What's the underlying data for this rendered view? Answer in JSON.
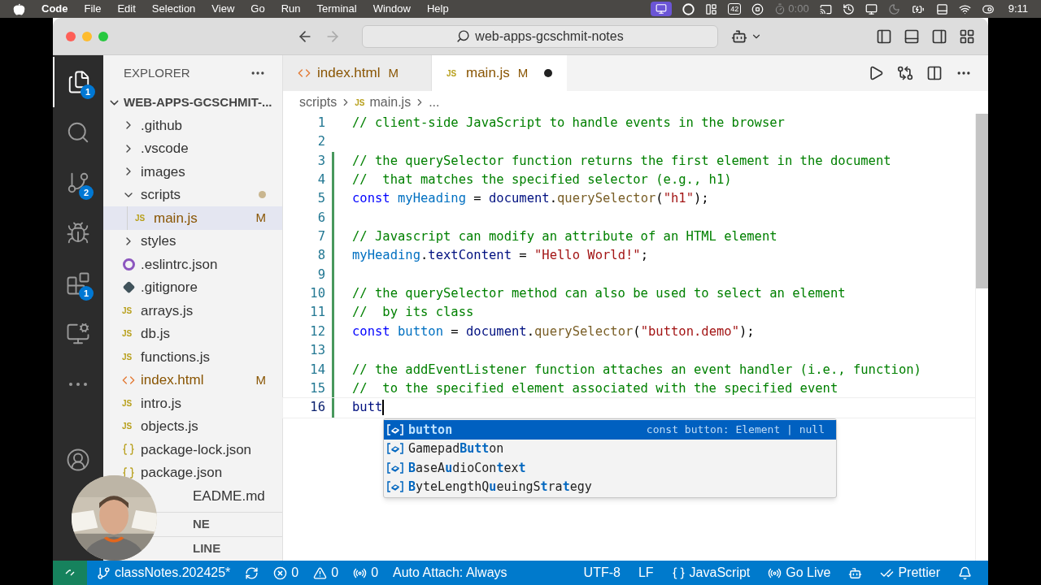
{
  "menu_bar": {
    "app": "Code",
    "menus": [
      "File",
      "Edit",
      "Selection",
      "View",
      "Go",
      "Run",
      "Terminal",
      "Window",
      "Help"
    ],
    "badge": "42",
    "timer": "0:00",
    "clock": "9:11"
  },
  "title_bar": {
    "search": "web-apps-gcschmit-notes"
  },
  "activity_bar": {
    "top": [
      {
        "kind": "files",
        "selected": true,
        "badge": "1"
      },
      {
        "kind": "search",
        "selected": false
      },
      {
        "kind": "source-control",
        "selected": false,
        "badge": "2"
      },
      {
        "kind": "run",
        "selected": false
      },
      {
        "kind": "extensions",
        "selected": false,
        "badge": "1"
      },
      {
        "kind": "remote",
        "selected": false
      },
      {
        "kind": "more",
        "selected": false
      }
    ],
    "bottom": [
      {
        "kind": "account",
        "selected": false
      }
    ]
  },
  "sidebar": {
    "title": "EXPLORER",
    "root": {
      "label": "WEB-APPS-GCSCHMIT-...",
      "expanded": true
    },
    "items": [
      {
        "label": ".github",
        "kind": "folder",
        "expanded": false,
        "selected": false
      },
      {
        "label": ".vscode",
        "kind": "folder",
        "expanded": false,
        "selected": false
      },
      {
        "label": "images",
        "kind": "folder",
        "expanded": false,
        "selected": false
      },
      {
        "label": "scripts",
        "kind": "folder",
        "expanded": true,
        "dot": true,
        "selected": false,
        "children": [
          {
            "label": "main.js",
            "kind": "js",
            "icon_text": "JS",
            "badge": "M",
            "selected": true
          }
        ]
      },
      {
        "label": "styles",
        "kind": "folder",
        "expanded": false,
        "selected": false
      },
      {
        "label": ".eslintrc.json",
        "kind": "eslint",
        "selected": false
      },
      {
        "label": ".gitignore",
        "kind": "git",
        "selected": false
      },
      {
        "label": "arrays.js",
        "kind": "js",
        "icon_text": "JS",
        "selected": false
      },
      {
        "label": "db.js",
        "kind": "js",
        "icon_text": "JS",
        "selected": false
      },
      {
        "label": "functions.js",
        "kind": "js",
        "icon_text": "JS",
        "selected": false
      },
      {
        "label": "index.html",
        "kind": "html",
        "badge": "M",
        "selected": false
      },
      {
        "label": "intro.js",
        "kind": "js",
        "icon_text": "JS",
        "selected": false
      },
      {
        "label": "objects.js",
        "kind": "js",
        "icon_text": "JS",
        "selected": false
      },
      {
        "label": "package-lock.json",
        "kind": "json",
        "selected": false
      },
      {
        "label": "package.json",
        "kind": "json",
        "selected": false
      },
      {
        "label": "EADME.md",
        "kind": "md",
        "occluded": true,
        "selected": false
      }
    ],
    "sections": [
      "NE",
      "LINE"
    ]
  },
  "tabs": [
    {
      "label": "index.html",
      "kind": "html",
      "badge": "M",
      "selected": false,
      "dirty": false
    },
    {
      "label": "main.js",
      "kind": "js",
      "icon_text": "JS",
      "badge": "M",
      "selected": true,
      "dirty": true
    }
  ],
  "breadcrumb": [
    {
      "label": "scripts"
    },
    {
      "label": "main.js",
      "icon_text": "JS"
    },
    {
      "label": "..."
    }
  ],
  "editor": {
    "lines": [
      {
        "n": "1",
        "modified": false,
        "tokens": [
          {
            "kind": "comment",
            "text": "// client-side JavaScript to handle events in the browser"
          }
        ]
      },
      {
        "n": "2",
        "modified": false
      },
      {
        "n": "3",
        "modified": true,
        "tokens": [
          {
            "kind": "comment",
            "text": "// the querySelector function returns the first element in the document"
          }
        ]
      },
      {
        "n": "4",
        "modified": true,
        "tokens": [
          {
            "kind": "comment",
            "text": "//  that matches the specified selector (e.g., h1)"
          }
        ]
      },
      {
        "n": "5",
        "modified": true,
        "tokens": [
          {
            "kind": "keyword",
            "text": "const"
          },
          {
            "kind": "variable",
            "text": " myHeading"
          },
          {
            "kind": "plain",
            "text": " = "
          },
          {
            "kind": "property",
            "text": "document"
          },
          {
            "kind": "plain",
            "text": "."
          },
          {
            "kind": "function",
            "text": "querySelector"
          },
          {
            "kind": "plain",
            "text": "("
          },
          {
            "kind": "string",
            "text": "\"h1\""
          },
          {
            "kind": "plain",
            "text": ");"
          }
        ]
      },
      {
        "n": "6",
        "modified": true
      },
      {
        "n": "7",
        "modified": true,
        "tokens": [
          {
            "kind": "comment",
            "text": "// Javascript can modify an attribute of an HTML element"
          }
        ]
      },
      {
        "n": "8",
        "modified": true,
        "tokens": [
          {
            "kind": "variable",
            "text": "myHeading"
          },
          {
            "kind": "plain",
            "text": "."
          },
          {
            "kind": "property",
            "text": "textContent"
          },
          {
            "kind": "plain",
            "text": " = "
          },
          {
            "kind": "string",
            "text": "\"Hello World!\""
          },
          {
            "kind": "plain",
            "text": ";"
          }
        ]
      },
      {
        "n": "9",
        "modified": true
      },
      {
        "n": "10",
        "modified": true,
        "tokens": [
          {
            "kind": "comment",
            "text": "// the querySelector method can also be used to select an element"
          }
        ]
      },
      {
        "n": "11",
        "modified": true,
        "tokens": [
          {
            "kind": "comment",
            "text": "//  by its class"
          }
        ]
      },
      {
        "n": "12",
        "modified": true,
        "tokens": [
          {
            "kind": "keyword",
            "text": "const"
          },
          {
            "kind": "variable",
            "text": " button"
          },
          {
            "kind": "plain",
            "text": " = "
          },
          {
            "kind": "property",
            "text": "document"
          },
          {
            "kind": "plain",
            "text": "."
          },
          {
            "kind": "function",
            "text": "querySelector"
          },
          {
            "kind": "plain",
            "text": "("
          },
          {
            "kind": "string",
            "text": "\"button.demo\""
          },
          {
            "kind": "plain",
            "text": ");"
          }
        ]
      },
      {
        "n": "13",
        "modified": true
      },
      {
        "n": "14",
        "modified": true,
        "tokens": [
          {
            "kind": "comment",
            "text": "// the addEventListener function attaches an event handler (i.e., function)"
          }
        ]
      },
      {
        "n": "15",
        "modified": true,
        "tokens": [
          {
            "kind": "comment",
            "text": "//  to the specified element associated with the specified event"
          }
        ]
      },
      {
        "n": "16",
        "modified": true,
        "current": true,
        "tokens": [
          {
            "kind": "property",
            "text": "butt"
          }
        ]
      }
    ],
    "suggestions": [
      {
        "label": "**button**",
        "detail": "const button: Element | null",
        "selected": true
      },
      {
        "label": "Gamepad**Butt**on",
        "selected": false
      },
      {
        "label": "**B**aseA**u**dioCon**t**ex**t**",
        "selected": false
      },
      {
        "label": "**B**yteLengthQ**u**euingS**t**ra**t**egy",
        "selected": false
      }
    ]
  },
  "status_bar": {
    "left": [
      {
        "kind": "branch",
        "text": "classNotes.202425*"
      },
      {
        "kind": "sync"
      },
      {
        "kind": "error",
        "text": "0"
      },
      {
        "kind": "warning",
        "text": "0"
      },
      {
        "kind": "ports",
        "text": "0"
      },
      {
        "kind": "plain",
        "text": "Auto Attach: Always"
      }
    ],
    "right": [
      {
        "kind": "plain",
        "text": "UTF-8"
      },
      {
        "kind": "plain",
        "text": "LF"
      },
      {
        "kind": "braces",
        "text": "JavaScript"
      },
      {
        "kind": "broadcast",
        "text": "Go Live"
      },
      {
        "kind": "copilot"
      },
      {
        "kind": "checks",
        "text": "Prettier"
      },
      {
        "kind": "bell"
      }
    ]
  }
}
